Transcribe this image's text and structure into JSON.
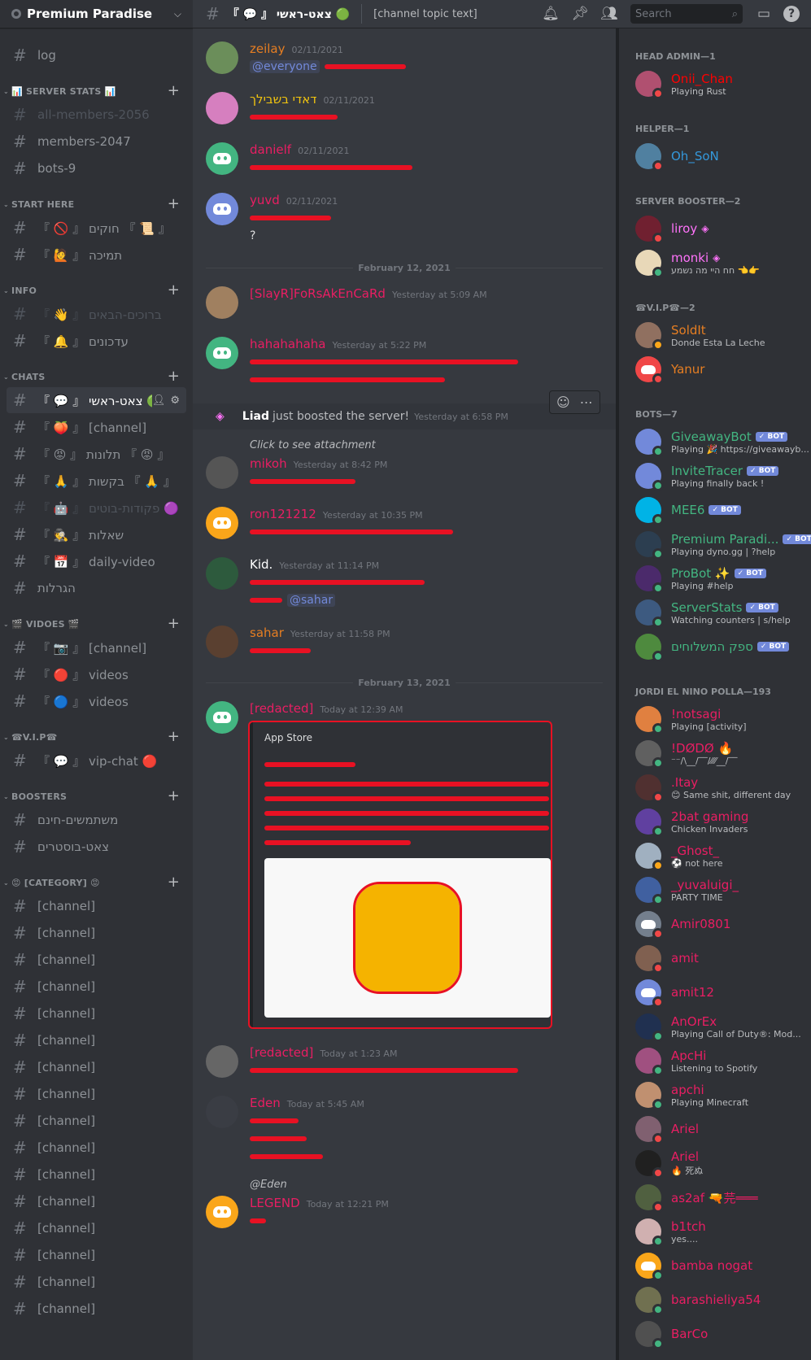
{
  "guild": {
    "name": "Premium Paradise"
  },
  "channel_header": {
    "name": "『 💬 』 צאט-ראשי 🟢",
    "topic": "[channel topic text]",
    "search_placeholder": "Search"
  },
  "sidebar": {
    "top_channels": [
      {
        "name": "log",
        "muted": false
      }
    ],
    "categories": [
      {
        "label": "📊 SERVER STATS 📊",
        "channels": [
          {
            "name": "all-members-2056",
            "muted": true
          },
          {
            "name": "members-2047",
            "muted": false
          },
          {
            "name": "bots-9",
            "muted": false
          }
        ]
      },
      {
        "label": "START HERE",
        "channels": [
          {
            "name": "『 🚫 』 חוקים 『 📜 』",
            "muted": false
          },
          {
            "name": "『 🙋 』 תמיכה",
            "muted": false
          }
        ]
      },
      {
        "label": "INFO",
        "channels": [
          {
            "name": "『 👋 』 ברוכים-הבאים",
            "muted": true
          },
          {
            "name": "『 🔔 』 עדכונים",
            "muted": false
          }
        ]
      },
      {
        "label": "CHATS",
        "channels": [
          {
            "name": "『 💬 』 צאט-ראשי 🟢",
            "muted": false,
            "active": true
          },
          {
            "name": "『 🍑 』 [channel]",
            "muted": false
          },
          {
            "name": "『 😡 』 תלונות 『 😡 』",
            "muted": false
          },
          {
            "name": "『 🙏 』 בקשות 『 🙏 』",
            "muted": false
          },
          {
            "name": "『 🤖 』 פקודות-בוטים 🟣",
            "muted": true
          },
          {
            "name": "『 🕵️ 』 שאלות",
            "muted": false
          },
          {
            "name": "『 📅 』 daily-video",
            "muted": false
          },
          {
            "name": "הגרלות",
            "muted": false
          }
        ]
      },
      {
        "label": "🎬 VIDOES 🎬",
        "channels": [
          {
            "name": "『 📷 』 [channel]",
            "muted": false
          },
          {
            "name": "『 🔴 』 videos",
            "muted": false
          },
          {
            "name": "『 🔵 』 videos",
            "muted": false
          }
        ]
      },
      {
        "label": "☎V.I.P☎",
        "channels": [
          {
            "name": "『 💬 』 vip-chat 🔴",
            "muted": false
          }
        ]
      },
      {
        "label": "BOOSTERS",
        "channels": [
          {
            "name": "משתמשים-חינם",
            "muted": false
          },
          {
            "name": "צאט-בוסטרים",
            "muted": false
          }
        ]
      },
      {
        "label": "😡 [category] 😡",
        "channels": [
          {
            "name": "[channel]",
            "muted": false
          },
          {
            "name": "[channel]",
            "muted": false
          },
          {
            "name": "[channel]",
            "muted": false
          },
          {
            "name": "[channel]",
            "muted": false
          },
          {
            "name": "[channel]",
            "muted": false
          },
          {
            "name": "[channel]",
            "muted": false
          },
          {
            "name": "[channel]",
            "muted": false
          },
          {
            "name": "[channel]",
            "muted": false
          },
          {
            "name": "[channel]",
            "muted": false
          },
          {
            "name": "[channel]",
            "muted": false
          },
          {
            "name": "[channel]",
            "muted": false
          },
          {
            "name": "[channel]",
            "muted": false
          },
          {
            "name": "[channel]",
            "muted": false
          },
          {
            "name": "[channel]",
            "muted": false
          },
          {
            "name": "[channel]",
            "muted": false
          },
          {
            "name": "[channel]",
            "muted": false
          }
        ]
      }
    ]
  },
  "messages": [
    {
      "type": "msg",
      "user": "zeilay",
      "color": "#e67e22",
      "ts": "02/11/2021",
      "avatar": "#6b8e5a",
      "mention": "@everyone",
      "redactions": [
        100
      ]
    },
    {
      "type": "msg",
      "user": "דאדי בשבילך",
      "color": "#f1c40f",
      "ts": "02/11/2021",
      "avatar": "#d67fbf",
      "redactions": [
        108
      ]
    },
    {
      "type": "msg",
      "user": "danielf",
      "color": "#e91e63",
      "ts": "02/11/2021",
      "avatar": "#43b581",
      "discord": true,
      "redactions": [
        200
      ]
    },
    {
      "type": "msg",
      "user": "yuvd",
      "color": "#e91e63",
      "ts": "02/11/2021",
      "avatar": "#7289da",
      "discord": true,
      "redactions": [
        100
      ],
      "extra": "?"
    },
    {
      "type": "divider",
      "label": "February 12, 2021"
    },
    {
      "type": "msg",
      "user": "[SlayR]FoRsAkEnCaRd",
      "color": "#e91e63",
      "ts": "Yesterday at 5:09 AM",
      "avatar": "#a08060",
      "redactions": []
    },
    {
      "type": "msg",
      "user": "hahahahaha",
      "color": "#e91e63",
      "ts": "Yesterday at 5:22 PM",
      "avatar": "#43b581",
      "discord": true,
      "redactions": [
        330,
        240
      ]
    },
    {
      "type": "system",
      "user": "Liad",
      "text": "just boosted the server!",
      "ts": "Yesterday at 6:58 PM"
    },
    {
      "type": "msg",
      "user": "mikoh",
      "color": "#e91e63",
      "ts": "Yesterday at 8:42 PM",
      "avatar": "#555",
      "reply": "Click to see attachment",
      "redactions": [
        130
      ]
    },
    {
      "type": "msg",
      "user": "ron121212",
      "color": "#e91e63",
      "ts": "Yesterday at 10:35 PM",
      "avatar": "#faa61a",
      "discord": true,
      "redactions": [
        250
      ]
    },
    {
      "type": "msg",
      "user": "Kid.",
      "color": "#ffffff",
      "ts": "Yesterday at 11:14 PM",
      "avatar": "#2d5a3d",
      "mention": "@sahar",
      "redactions": [
        215,
        40
      ]
    },
    {
      "type": "msg",
      "user": "sahar",
      "color": "#e67e22",
      "ts": "Yesterday at 11:58 PM",
      "avatar": "#5a4030",
      "redactions": [
        75
      ]
    },
    {
      "type": "divider",
      "label": "February 13, 2021"
    },
    {
      "type": "embed-msg",
      "user": "[redacted]",
      "color": "#e91e63",
      "ts": "Today at 12:39 AM",
      "avatar": "#43b581",
      "discord": true,
      "embed": {
        "provider": "App Store"
      }
    },
    {
      "type": "msg",
      "user": "[redacted]",
      "color": "#e91e63",
      "ts": "Today at 1:23 AM",
      "avatar": "#666",
      "redactions": [
        330
      ]
    },
    {
      "type": "msg",
      "user": "Eden",
      "color": "#e91e63",
      "ts": "Today at 5:45 AM",
      "avatar": "#3a3d44",
      "redactions": [
        60,
        70,
        90
      ]
    },
    {
      "type": "msg",
      "user": "LEGEND",
      "color": "#e91e63",
      "ts": "Today at 12:21 PM",
      "avatar": "#faa61a",
      "discord": true,
      "reply": "@Eden",
      "redactions": [
        20
      ]
    }
  ],
  "members": {
    "groups": [
      {
        "label": "HEAD ADMIN—1",
        "items": [
          {
            "name": "Onii_Chan",
            "color": "#ff0000",
            "activity": "Playing Rust",
            "status": "#f04747",
            "av": "#b05070"
          }
        ]
      },
      {
        "label": "HELPER—1",
        "items": [
          {
            "name": "Oh_SoN",
            "color": "#3498db",
            "status": "#f04747",
            "av": "#5080a0"
          }
        ]
      },
      {
        "label": "SERVER BOOSTER—2",
        "items": [
          {
            "name": "liroy",
            "color": "#ff73fa",
            "boost": true,
            "status": "#f04747",
            "av": "#702030"
          },
          {
            "name": "monki",
            "color": "#ff73fa",
            "boost": true,
            "activity": "חח היי מה נשמע 👈👉",
            "status": "#43b581",
            "av": "#e8d8b8"
          }
        ]
      },
      {
        "label": "☎V.I.P☎—2",
        "items": [
          {
            "name": "SoldIt",
            "color": "#e67e22",
            "activity": "Donde Esta La Leche",
            "status": "#faa61a",
            "av": "#907060"
          },
          {
            "name": "Yanur",
            "color": "#e67e22",
            "status": "#f04747",
            "av": "#f04747",
            "discord": true
          }
        ]
      },
      {
        "label": "BOTS—7",
        "items": [
          {
            "name": "GiveawayBot",
            "color": "#43b581",
            "bot": true,
            "activity": "Playing 🎉 https://giveawayb...",
            "status": "#43b581",
            "av": "#7289da"
          },
          {
            "name": "InviteTracer",
            "color": "#43b581",
            "bot": true,
            "activity": "Playing finally back !",
            "status": "#43b581",
            "av": "#7289da"
          },
          {
            "name": "MEE6",
            "color": "#43b581",
            "bot": true,
            "status": "#43b581",
            "av": "#00b3e6"
          },
          {
            "name": "Premium Paradi...",
            "color": "#43b581",
            "bot": true,
            "activity": "Playing dyno.gg | ?help",
            "status": "#43b581",
            "av": "#2c3e50"
          },
          {
            "name": "ProBot ✨",
            "color": "#43b581",
            "bot": true,
            "activity": "Playing #help",
            "status": "#43b581",
            "av": "#4b2a6b"
          },
          {
            "name": "ServerStats",
            "color": "#43b581",
            "bot": true,
            "activity": "Watching counters | s/help",
            "status": "#43b581",
            "av": "#3d5a80"
          },
          {
            "name": "ספק המשלוחים",
            "color": "#43b581",
            "bot": true,
            "status": "#43b581",
            "av": "#4e8a3e"
          }
        ]
      },
      {
        "label": "JORDI EL NINO POLLA—193",
        "items": [
          {
            "name": "!notsagi",
            "color": "#e91e63",
            "activity": "Playing [activity]",
            "status": "#43b581",
            "av": "#e08040"
          },
          {
            "name": "!DØDØ 🔥",
            "color": "#e91e63",
            "activity": "⁻⁻/\\__/‾‾/⁄⁄⁄⁄__/‾‾",
            "status": "#43b581",
            "av": "#606060"
          },
          {
            "name": ".Itay",
            "color": "#e91e63",
            "activity": "😊 Same shit, different day",
            "status": "#f04747",
            "av": "#503030"
          },
          {
            "name": "2bat gaming",
            "color": "#e91e63",
            "activity": "Chicken Invaders",
            "status": "#43b581",
            "av": "#6040a0"
          },
          {
            "name": "_Ghost_",
            "color": "#e91e63",
            "activity": "⚽ not here",
            "status": "#faa61a",
            "av": "#a0b0c0"
          },
          {
            "name": "_yuvaluigi_",
            "color": "#e91e63",
            "activity": "PARTY TIME",
            "status": "#43b581",
            "av": "#4060a0"
          },
          {
            "name": "Amir0801",
            "color": "#e91e63",
            "status": "#f04747",
            "av": "#747f8d",
            "discord": true
          },
          {
            "name": "amit",
            "color": "#e91e63",
            "status": "#f04747",
            "av": "#806050"
          },
          {
            "name": "amit12",
            "color": "#e91e63",
            "status": "#f04747",
            "av": "#7289da",
            "discord": true
          },
          {
            "name": "AnOrEx",
            "color": "#e91e63",
            "activity": "Playing Call of Duty®: Mod...",
            "status": "#43b581",
            "av": "#203050"
          },
          {
            "name": "ApcHi",
            "color": "#e91e63",
            "activity": "Listening to Spotify",
            "status": "#43b581",
            "av": "#a05080"
          },
          {
            "name": "apchi",
            "color": "#e91e63",
            "activity": "Playing Minecraft",
            "status": "#43b581",
            "av": "#c09070"
          },
          {
            "name": "Ariel",
            "color": "#e91e63",
            "status": "#f04747",
            "av": "#806070"
          },
          {
            "name": "Ariel",
            "color": "#e91e63",
            "activity": "🔥 死ぬ",
            "status": "#f04747",
            "av": "#202020"
          },
          {
            "name": "as2af 🔫芫═══",
            "color": "#e91e63",
            "status": "#f04747",
            "av": "#506040"
          },
          {
            "name": "b1tch",
            "color": "#e91e63",
            "activity": "yes....",
            "status": "#43b581",
            "av": "#d0b0b0"
          },
          {
            "name": "bamba nogat",
            "color": "#e91e63",
            "status": "#43b581",
            "av": "#faa61a",
            "discord": true
          },
          {
            "name": "barashieliya54",
            "color": "#e91e63",
            "status": "#43b581",
            "av": "#707050"
          },
          {
            "name": "BarCo",
            "color": "#e91e63",
            "status": "#43b581",
            "av": "#505050"
          }
        ]
      }
    ]
  }
}
